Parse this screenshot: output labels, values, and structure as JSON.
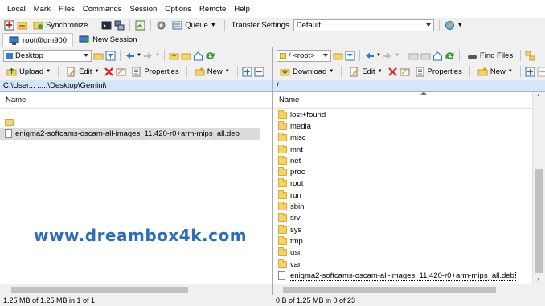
{
  "menu": [
    "Local",
    "Mark",
    "Files",
    "Commands",
    "Session",
    "Options",
    "Remote",
    "Help"
  ],
  "toolbar": {
    "synchronize": "Synchronize",
    "queue": "Queue",
    "transfer_settings_label": "Transfer Settings",
    "transfer_settings_value": "Default"
  },
  "tabs": [
    {
      "label": "root@dm900"
    },
    {
      "label": "New Session"
    }
  ],
  "left": {
    "location": "Desktop",
    "upload": "Upload",
    "edit": "Edit",
    "properties": "Properties",
    "new": "New",
    "path": "C:\\User...  .....\\Desktop\\Gemini\\",
    "column": "Name",
    "items": [
      {
        "name": "..",
        "type": "updir"
      },
      {
        "name": "enigma2-softcams-oscam-all-images_11.420-r0+arm-mips_all.deb",
        "type": "file"
      }
    ],
    "status": "1.25 MB of 1.25 MB in 1 of 1"
  },
  "right": {
    "location": "/ <root>",
    "find_files": "Find Files",
    "download": "Download",
    "edit": "Edit",
    "properties": "Properties",
    "new": "New",
    "path": "/",
    "column": "Name",
    "items": [
      {
        "name": "lost+found",
        "type": "folder"
      },
      {
        "name": "media",
        "type": "folder"
      },
      {
        "name": "misc",
        "type": "folder"
      },
      {
        "name": "mnt",
        "type": "folder"
      },
      {
        "name": "net",
        "type": "folder"
      },
      {
        "name": "proc",
        "type": "folder"
      },
      {
        "name": "root",
        "type": "folder"
      },
      {
        "name": "run",
        "type": "folder"
      },
      {
        "name": "sbin",
        "type": "folder"
      },
      {
        "name": "srv",
        "type": "folder"
      },
      {
        "name": "sys",
        "type": "folder"
      },
      {
        "name": "tmp",
        "type": "folder"
      },
      {
        "name": "usr",
        "type": "folder"
      },
      {
        "name": "var",
        "type": "folder"
      },
      {
        "name": "enigma2-softcams-oscam-all-images_11.420-r0+arm-mips_all.deb",
        "type": "file"
      }
    ],
    "status": "0 B of 1.25 MB in 0 of 23"
  },
  "watermark": "www.dreambox4k.com",
  "colors": {
    "accent": "#2f6fb1",
    "path_bar": "#d4e6f7",
    "folder": "#f6d46b"
  }
}
